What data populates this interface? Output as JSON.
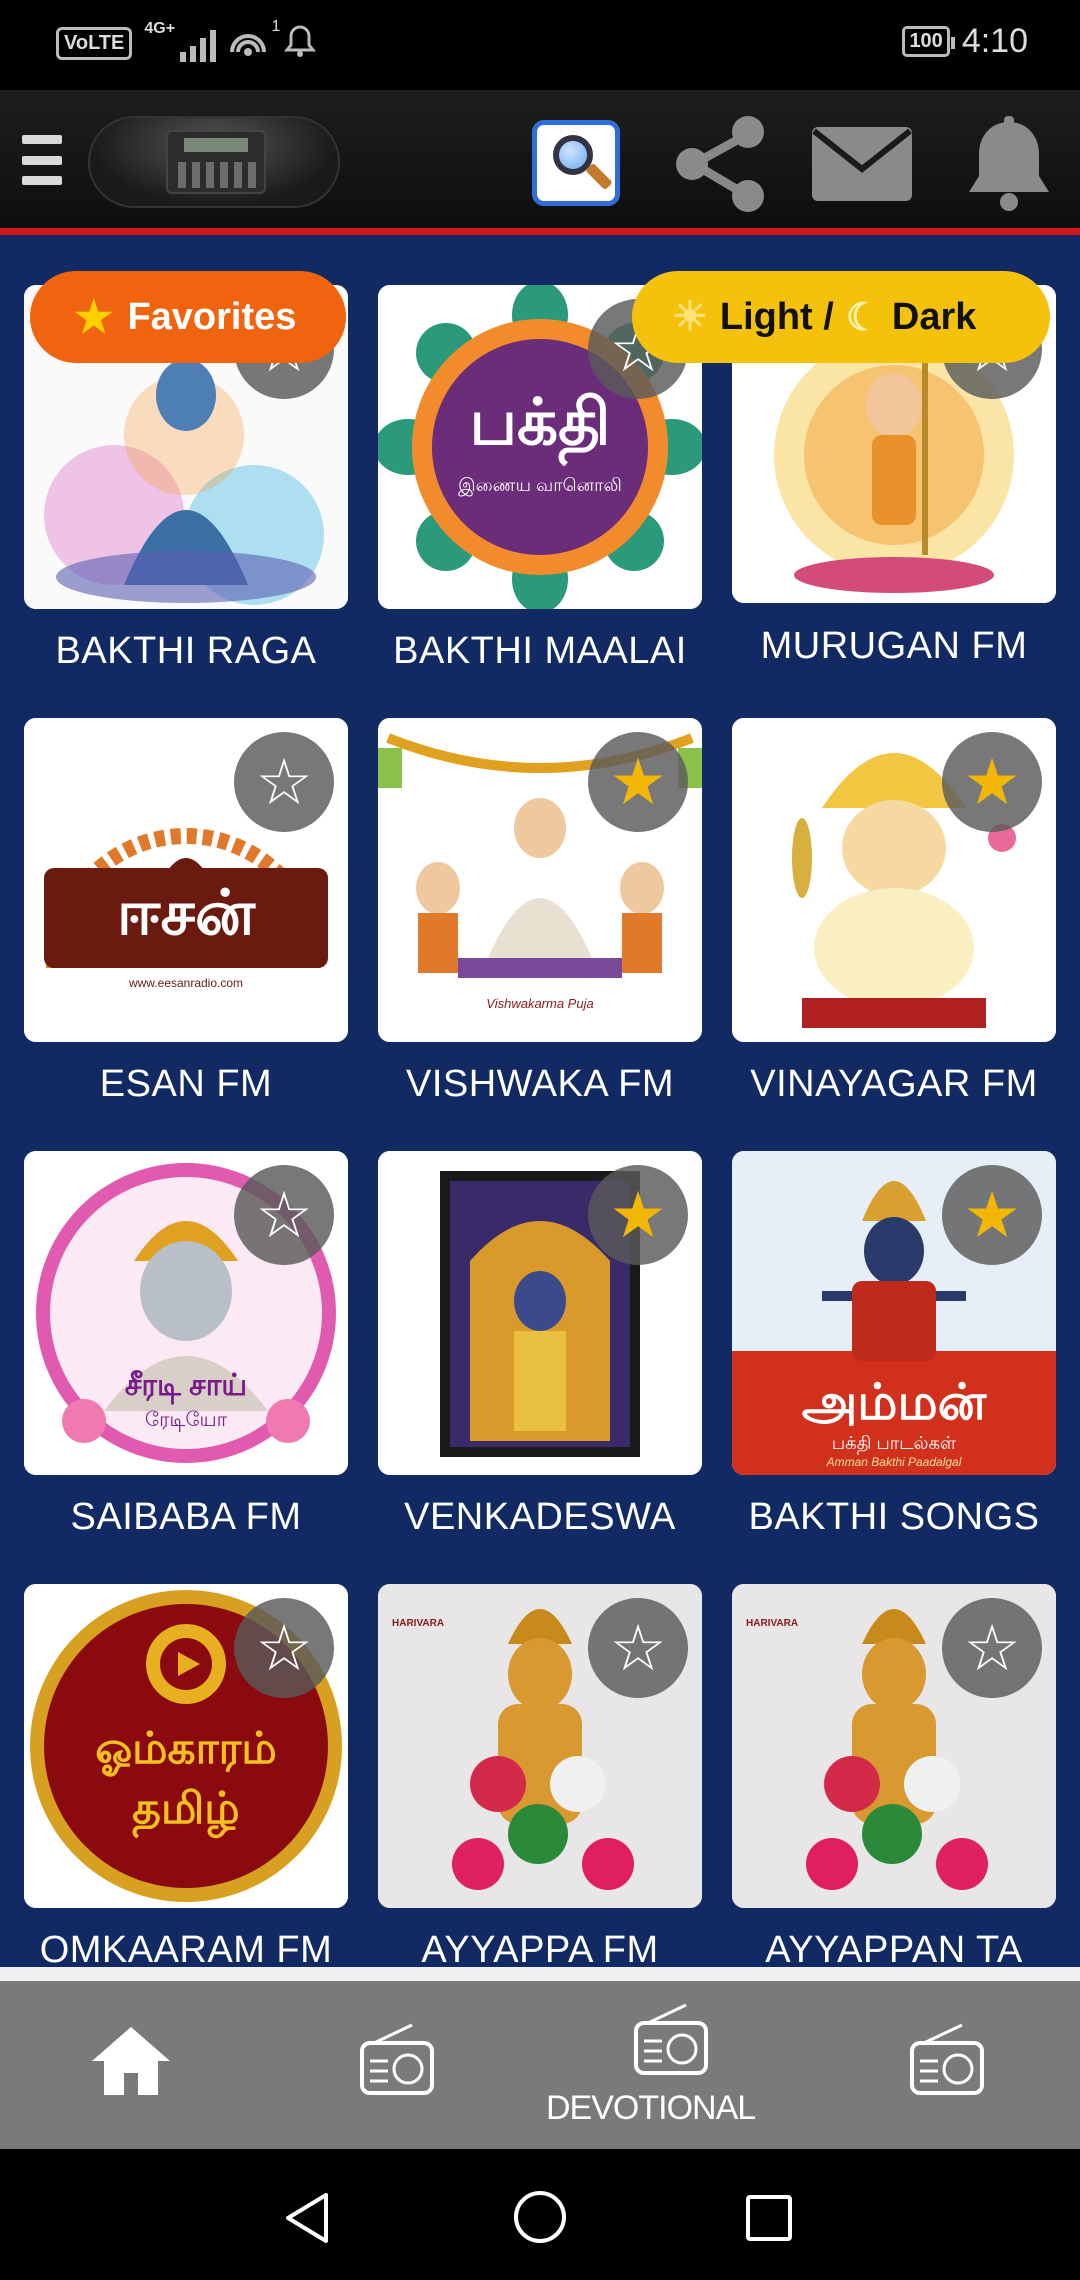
{
  "status_bar": {
    "volte": "VoLTE",
    "network": "4G+",
    "hotspot_count": "1",
    "battery": "100",
    "time": "4:10"
  },
  "header": {
    "icons": [
      "menu-icon",
      "radio-logo",
      "search-icon",
      "share-icon",
      "mail-icon",
      "bell-icon"
    ]
  },
  "overlay": {
    "favorites_label": "Favorites",
    "theme_label_light": "Light /",
    "theme_label_dark": "Dark"
  },
  "stations": [
    {
      "name": "BAKTHI RAGA",
      "favorite": false
    },
    {
      "name": "BAKTHI MAALAI",
      "favorite": false,
      "art_text": "பக்தி",
      "art_sub": "இணைய வானொலி"
    },
    {
      "name": "MURUGAN FM",
      "favorite": false
    },
    {
      "name": "ESAN FM",
      "favorite": false,
      "art_text": "ஈசன்",
      "art_sub": "www.eesanradio.com"
    },
    {
      "name": "VISHWAKA FM",
      "favorite": true,
      "art_sub": "Vishwakarma Puja"
    },
    {
      "name": "VINAYAGAR FM",
      "favorite": true
    },
    {
      "name": "SAIBABA FM",
      "favorite": false,
      "art_text": "சீரடி சாய்",
      "art_sub": "ரேடியோ"
    },
    {
      "name": "VENKADESWA",
      "favorite": true
    },
    {
      "name": "BAKTHI SONGS",
      "favorite": true,
      "art_text": "அம்மன்",
      "art_sub": "பக்தி பாடல்கள்",
      "art_sub2": "Amman Bakthi Paadalgal"
    },
    {
      "name": "OMKAARAM FM",
      "favorite": false,
      "art_text": "ஓம்காரம்",
      "art_sub": "தமிழ்"
    },
    {
      "name": "AYYAPPA FM",
      "favorite": false,
      "art_sub": "HARIVARA"
    },
    {
      "name": "AYYAPPAN TA",
      "favorite": false,
      "art_sub": "HARIVARA"
    }
  ],
  "bottom_nav": {
    "items": [
      "home-icon",
      "radio-icon",
      "radio-icon",
      "radio-icon"
    ],
    "active_label": "DEVOTIONAL"
  },
  "colors": {
    "content_bg": "#112a63",
    "accent_red": "#d01818",
    "favorites_orange": "#f0640f",
    "theme_yellow": "#f4c20d",
    "star_on": "#f2b705"
  }
}
